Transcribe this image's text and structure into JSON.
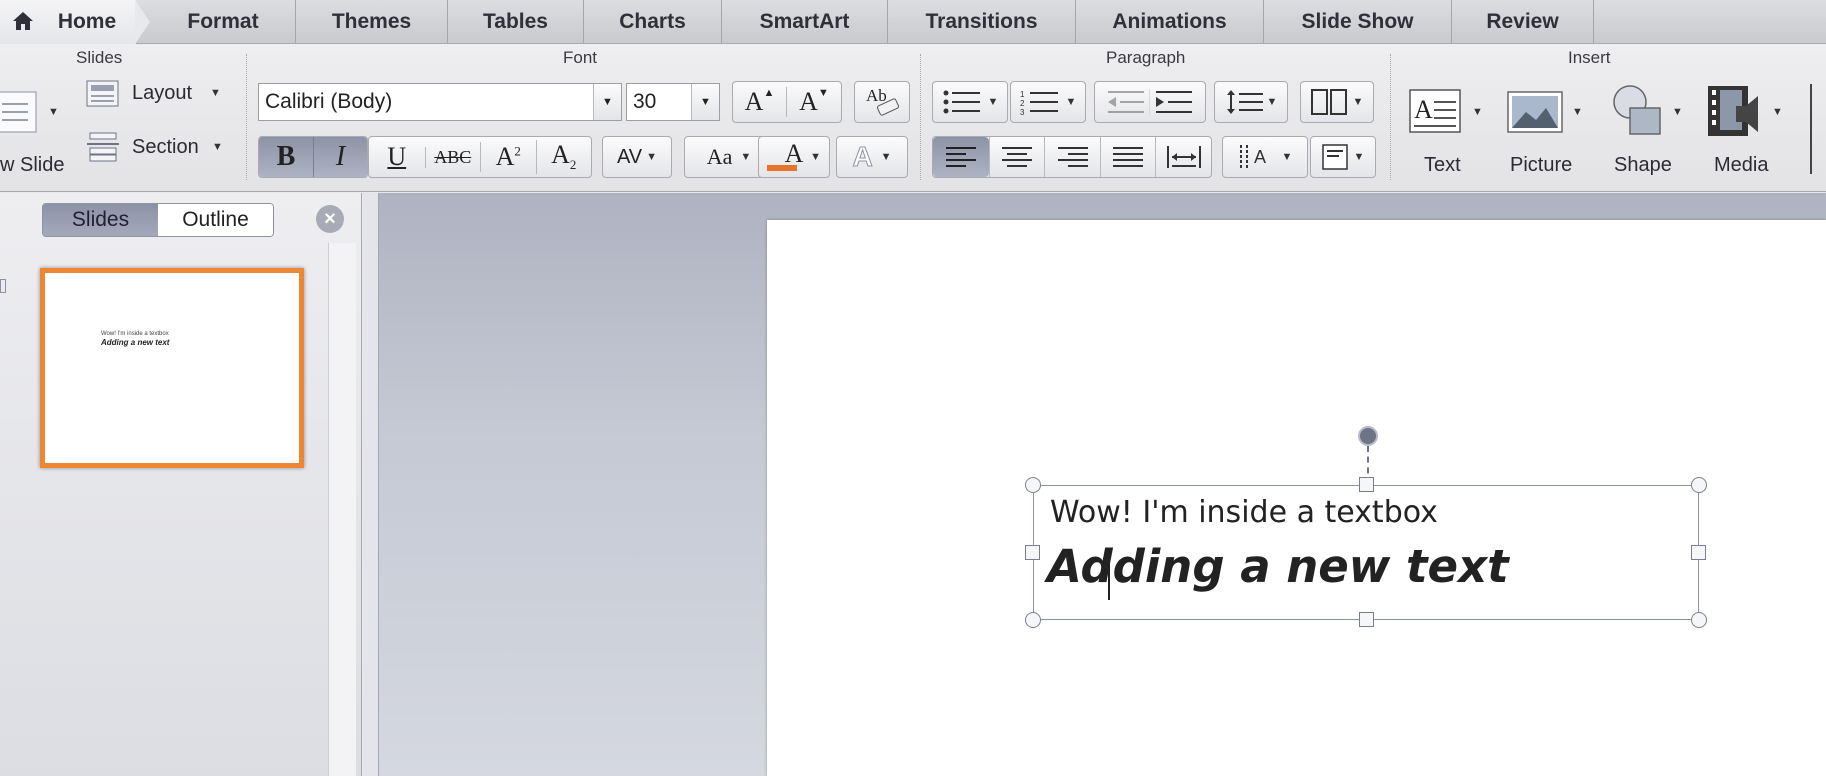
{
  "ribbon_tabs": [
    "Home",
    "Format",
    "Themes",
    "Tables",
    "Charts",
    "SmartArt",
    "Transitions",
    "Animations",
    "Slide Show",
    "Review"
  ],
  "groups": {
    "slides": {
      "label": "Slides",
      "new_slide": "w Slide",
      "layout": "Layout",
      "section": "Section"
    },
    "font": {
      "label": "Font",
      "font_name": "Calibri (Body)",
      "font_size": "30",
      "bold_active": true,
      "italic_active": true,
      "font_color": "#e8742c"
    },
    "paragraph": {
      "label": "Paragraph",
      "align_left_active": true
    },
    "insert": {
      "label": "Insert",
      "items": [
        "Text",
        "Picture",
        "Shape",
        "Media"
      ]
    }
  },
  "left_panel": {
    "tabs": [
      "Slides",
      "Outline"
    ],
    "selected_tab": "Slides",
    "thumbnail": {
      "line1": "Wow! I'm inside a textbox",
      "line2": "Adding a new text",
      "selected_color": "#ee8733"
    }
  },
  "slide": {
    "line1": "Wow! I'm inside a textbox",
    "line2": "Adding a new text"
  },
  "colors": {
    "accent": "#ee8733",
    "pressed": "#9097ab"
  }
}
